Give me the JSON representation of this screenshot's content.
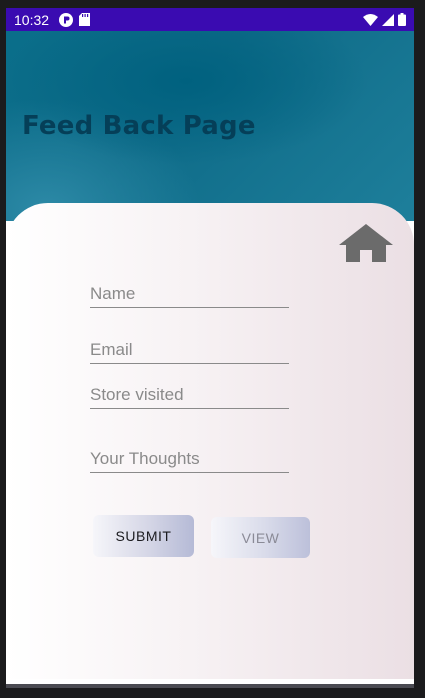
{
  "status_bar": {
    "time": "10:32",
    "left_icons": [
      "app-notification-icon",
      "sd-card-icon"
    ],
    "right_icons": [
      "wifi-icon",
      "signal-icon",
      "battery-icon"
    ],
    "background": "#3a0bb1"
  },
  "header": {
    "title": "Feed Back Page"
  },
  "form": {
    "fields": [
      {
        "placeholder": "Name",
        "value": ""
      },
      {
        "placeholder": "Email",
        "value": ""
      },
      {
        "placeholder": "Store visited",
        "value": ""
      },
      {
        "placeholder": "Your Thoughts",
        "value": ""
      }
    ],
    "submit_label": "SUBMIT",
    "view_label": "VIEW"
  },
  "colors": {
    "header_teal": "#0e6b88",
    "title": "#053f58",
    "home_icon": "#6b6b6b"
  }
}
